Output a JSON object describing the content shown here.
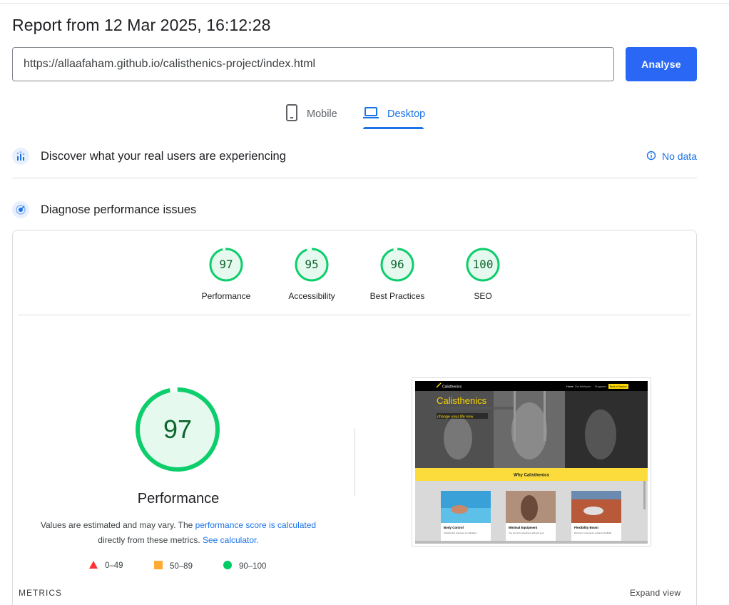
{
  "report": {
    "title": "Report from 12 Mar 2025, 16:12:28"
  },
  "search": {
    "url": "https://allaafaham.github.io/calisthenics-project/index.html",
    "analyse_label": "Analyse"
  },
  "tabs": [
    {
      "label": "Mobile",
      "icon": "phone-icon"
    },
    {
      "label": "Desktop",
      "icon": "laptop-icon",
      "selected": true
    }
  ],
  "field_data": {
    "title": "Discover what your real users are experiencing",
    "status": "No data"
  },
  "diagnose": {
    "title": "Diagnose performance issues"
  },
  "categories": [
    {
      "score": "97",
      "label": "Performance"
    },
    {
      "score": "95",
      "label": "Accessibility"
    },
    {
      "score": "96",
      "label": "Best Practices"
    },
    {
      "score": "100",
      "label": "SEO"
    }
  ],
  "performance": {
    "score": "97",
    "title": "Performance",
    "desc_prefix": "Values are estimated and may vary. The ",
    "desc_link1": "performance score is calculated",
    "desc_middle": " directly from these metrics. ",
    "desc_link2": "See calculator."
  },
  "legend": [
    {
      "range": "0–49",
      "color": "#f33"
    },
    {
      "range": "50–89",
      "color": "#fa3"
    },
    {
      "range": "90–100",
      "color": "#0c6"
    }
  ],
  "screenshot": {
    "brand": "Calisthenics",
    "nav": [
      "Home",
      "Our Workouts",
      "Programs"
    ],
    "cta": "Book a Session",
    "hero_title": "Calisthenics",
    "hero_subtitle": "change your life now",
    "section_title": "Why Calisthenics",
    "cards": [
      {
        "title": "Body Control",
        "text": "Calisthenics improves coordination."
      },
      {
        "title": "Minimal Equipment",
        "text": "You can train anywhere with just your"
      },
      {
        "title": "Flexibility Boost",
        "text": "Dynamic movements enhance flexibility"
      }
    ]
  },
  "footer": {
    "metrics_label": "METRICS",
    "expand_label": "Expand view"
  },
  "colors": {
    "accent": "#1a73e8",
    "pass": "#0cce6b",
    "pass_text": "#0d652d",
    "pass_fill": "#e6f9ef"
  }
}
